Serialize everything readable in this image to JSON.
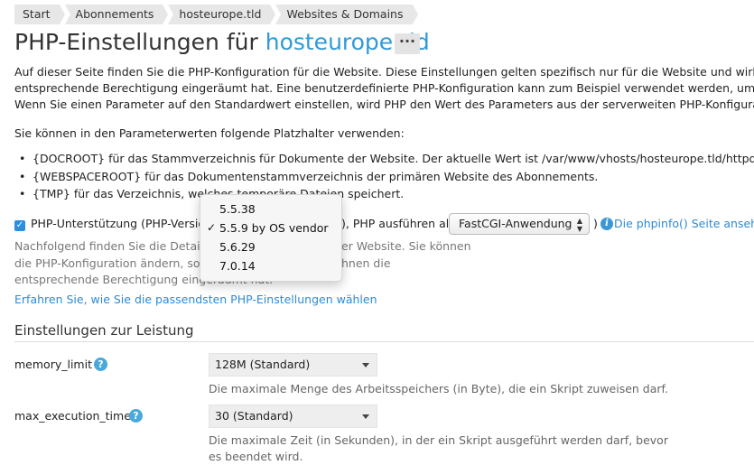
{
  "breadcrumb": [
    "Start",
    "Abonnements",
    "hosteurope.tld",
    "Websites & Domains"
  ],
  "title": {
    "prefix": "PHP-Einstellungen für",
    "domain": "hosteurope.tld",
    "more_label": "···"
  },
  "intro": {
    "line1": "Auf dieser Seite finden Sie die PHP-Konfiguration für die Website. Diese Einstellungen gelten spezifisch nur für die Website und wirken s",
    "line2": "entsprechende Berechtigung eingeräumt hat. Eine benutzerdefinierte PHP-Konfiguration kann zum Beispiel verwendet werden, um den",
    "line3": "Wenn Sie einen Parameter auf den Standardwert einstellen, wird PHP den Wert des Parameters aus der serverweiten PHP-Konfiguration"
  },
  "placeholders": {
    "intro": "Sie können in den Parameterwerten folgende Platzhalter verwenden:",
    "items": [
      "{DOCROOT} für das Stammverzeichnis für Dokumente der Website. Der aktuelle Wert ist /var/www/vhosts/hosteurope.tld/httpdocs.",
      "{WEBSPACEROOT} für das Dokumentenstammverzeichnis der primären Website des Abonnements.",
      "{TMP} für das Verzeichnis, welches temporäre Dateien speichert."
    ]
  },
  "php_support": {
    "label_start": "PHP-Unterstützung (PHP-Versio",
    "label_mid": "), PHP ausführen als",
    "handler_value": "FastCGI-Anwendung",
    "close_paren": ")",
    "phpinfo_link": "Die phpinfo() Seite anseh"
  },
  "details": {
    "line1a": "Nachfolgend finden Sie die Details",
    "line1b": "er Website. Sie können",
    "line2a": "die PHP-Konfiguration ändern, sof",
    "line2b": "hnen die",
    "line3": "entsprechende Berechtigung eingeräumt hat."
  },
  "learn_link": "Erfahren Sie, wie Sie die passendsten PHP-Einstellungen wählen",
  "version_dropdown": {
    "options": [
      "5.5.38",
      "5.5.9 by OS vendor",
      "5.6.29",
      "7.0.14"
    ],
    "selected_index": 1,
    "check_mark": "✓"
  },
  "performance": {
    "title": "Einstellungen zur Leistung",
    "fields": [
      {
        "name": "memory_limit",
        "value": "128M (Standard)",
        "hint_lines": [
          "Die maximale Menge des Arbeitsspeichers (in Byte), die ein Skript zuweisen darf."
        ]
      },
      {
        "name": "max_execution_time",
        "value": "30 (Standard)",
        "hint_lines": [
          "Die maximale Zeit (in Sekunden), in der ein Skript ausgeführt werden darf, bevor",
          "es beendet wird."
        ]
      }
    ]
  },
  "icons": {
    "help": "?",
    "info": "i",
    "checkbox": "✓"
  },
  "colors": {
    "link": "#2f8ad0",
    "title_domain": "#2f9ad8",
    "checkbox": "#2d8ee0",
    "help_icon": "#48a9dc"
  }
}
